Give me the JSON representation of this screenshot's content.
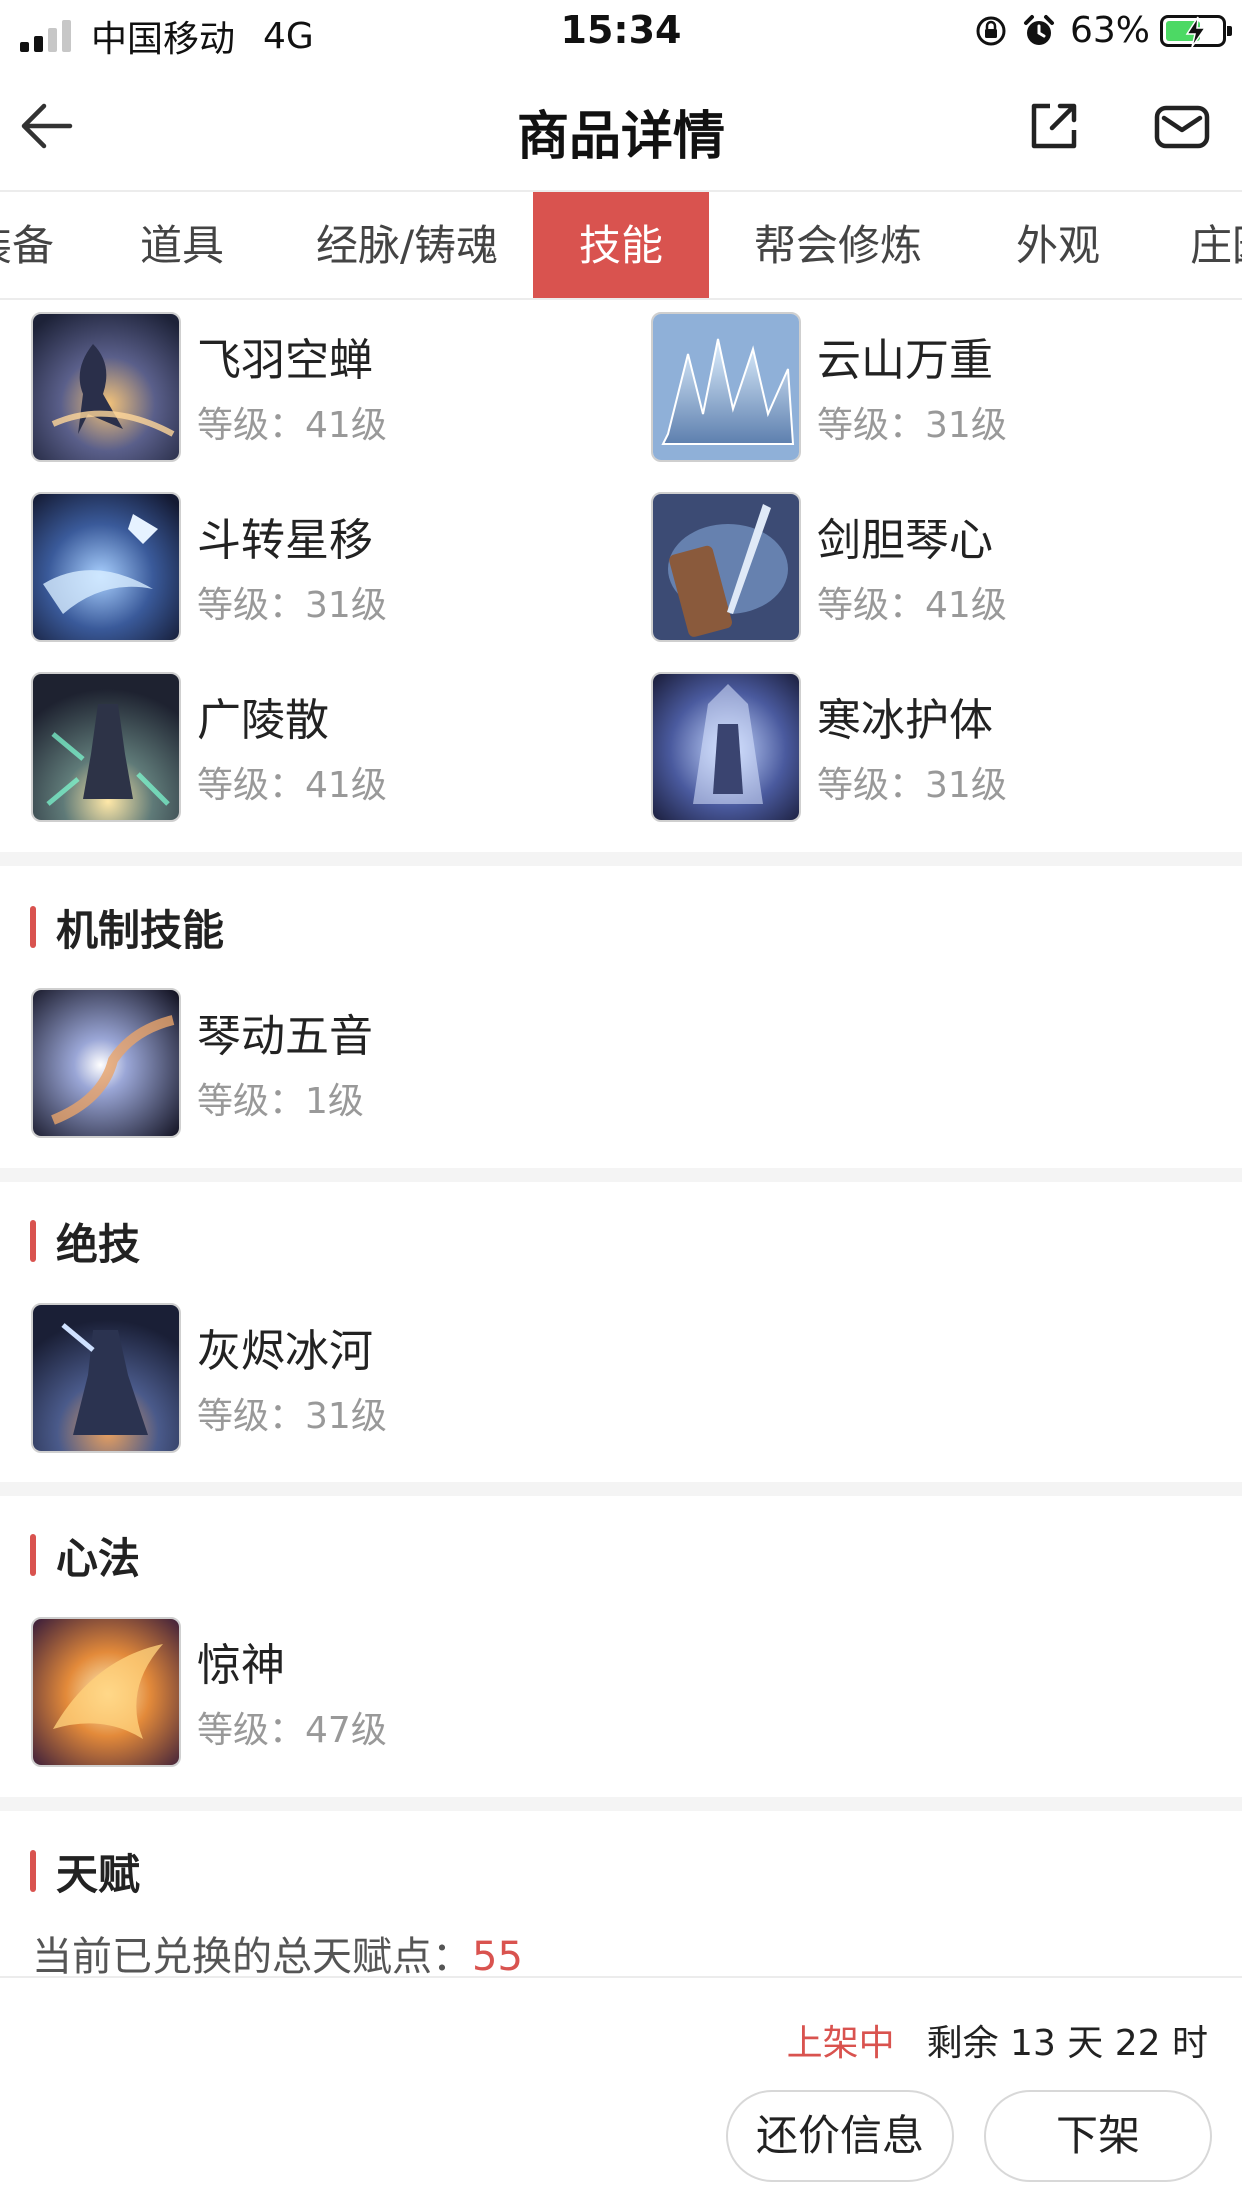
{
  "status_bar": {
    "carrier": "中国移动",
    "network": "4G",
    "time": "15:34",
    "battery_text": "63%",
    "battery_level": 0.63
  },
  "header": {
    "title": "商品详情"
  },
  "tabs": [
    {
      "label": "装备"
    },
    {
      "label": "道具"
    },
    {
      "label": "经脉/铸魂"
    },
    {
      "label": "技能"
    },
    {
      "label": "帮会修炼"
    },
    {
      "label": "外观"
    },
    {
      "label": "庄园"
    }
  ],
  "active_tab_index": 3,
  "skills": [
    {
      "name": "飞羽空蝉",
      "level_label": "等级：",
      "level": "41级"
    },
    {
      "name": "云山万重",
      "level_label": "等级：",
      "level": "31级"
    },
    {
      "name": "斗转星移",
      "level_label": "等级：",
      "level": "31级"
    },
    {
      "name": "剑胆琴心",
      "level_label": "等级：",
      "level": "41级"
    },
    {
      "name": "广陵散",
      "level_label": "等级：",
      "level": "41级"
    },
    {
      "name": "寒冰护体",
      "level_label": "等级：",
      "level": "31级"
    }
  ],
  "sections": {
    "mechanic": {
      "title": "机制技能",
      "items": [
        {
          "name": "琴动五音",
          "level_label": "等级：",
          "level": "1级"
        }
      ]
    },
    "ultimate": {
      "title": "绝技",
      "items": [
        {
          "name": "灰烬冰河",
          "level_label": "等级：",
          "level": "31级"
        }
      ]
    },
    "mind": {
      "title": "心法",
      "items": [
        {
          "name": "惊神",
          "level_label": "等级：",
          "level": "47级"
        }
      ]
    },
    "talent": {
      "title": "天赋",
      "total_label": "当前已兑换的总天赋点：",
      "total_value": "55"
    }
  },
  "footer": {
    "status": "上架中",
    "remaining": "剩余 13 天 22 时",
    "counter_offer_button": "还价信息",
    "delist_button": "下架"
  },
  "colors": {
    "accent": "#d9534f",
    "muted_text": "#999999",
    "divider": "#f4f4f4"
  }
}
